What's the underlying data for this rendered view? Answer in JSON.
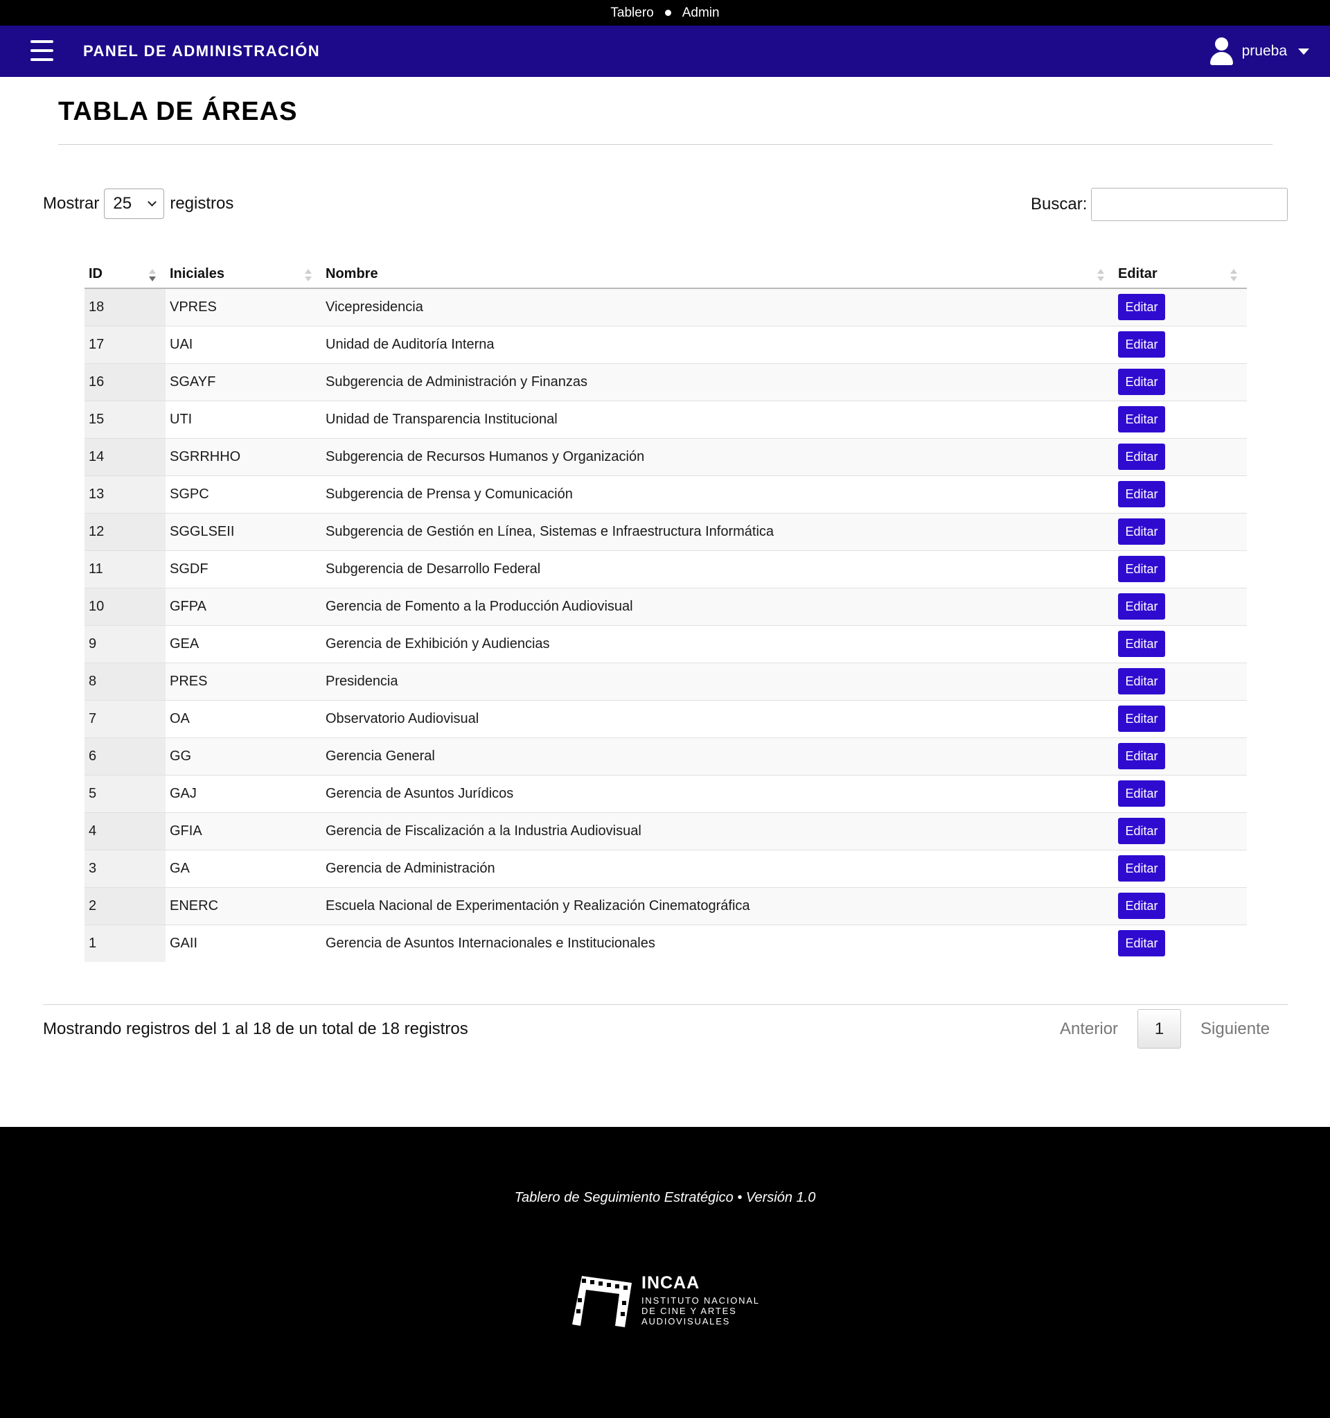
{
  "breadcrumb": {
    "home": "Tablero",
    "current": "Admin"
  },
  "header": {
    "title": "PANEL DE ADMINISTRACIÓN",
    "user": "prueba",
    "bg_color": "#1d0a8a"
  },
  "page": {
    "title": "TABLA DE ÁREAS"
  },
  "controls": {
    "show_label": "Mostrar",
    "page_length": "25",
    "records_label": "registros",
    "search_label": "Buscar:",
    "search_value": ""
  },
  "table": {
    "columns": [
      "ID",
      "Iniciales",
      "Nombre",
      "Editar"
    ],
    "edit_label": "Editar",
    "rows": [
      {
        "id": "18",
        "initials": "VPRES",
        "name": "Vicepresidencia"
      },
      {
        "id": "17",
        "initials": "UAI",
        "name": "Unidad de Auditoría Interna"
      },
      {
        "id": "16",
        "initials": "SGAYF",
        "name": "Subgerencia de Administración y Finanzas"
      },
      {
        "id": "15",
        "initials": "UTI",
        "name": "Unidad de Transparencia Institucional"
      },
      {
        "id": "14",
        "initials": "SGRRHHO",
        "name": "Subgerencia de Recursos Humanos y Organización"
      },
      {
        "id": "13",
        "initials": "SGPC",
        "name": "Subgerencia de Prensa y Comunicación"
      },
      {
        "id": "12",
        "initials": "SGGLSEII",
        "name": "Subgerencia de Gestión en Línea, Sistemas e Infraestructura Informática"
      },
      {
        "id": "11",
        "initials": "SGDF",
        "name": "Subgerencia de Desarrollo Federal"
      },
      {
        "id": "10",
        "initials": "GFPA",
        "name": "Gerencia de Fomento a la Producción Audiovisual"
      },
      {
        "id": "9",
        "initials": "GEA",
        "name": "Gerencia de Exhibición y Audiencias"
      },
      {
        "id": "8",
        "initials": "PRES",
        "name": "Presidencia"
      },
      {
        "id": "7",
        "initials": "OA",
        "name": "Observatorio Audiovisual"
      },
      {
        "id": "6",
        "initials": "GG",
        "name": "Gerencia General"
      },
      {
        "id": "5",
        "initials": "GAJ",
        "name": "Gerencia de Asuntos Jurídicos"
      },
      {
        "id": "4",
        "initials": "GFIA",
        "name": "Gerencia de Fiscalización a la Industria Audiovisual"
      },
      {
        "id": "3",
        "initials": "GA",
        "name": "Gerencia de Administración"
      },
      {
        "id": "2",
        "initials": "ENERC",
        "name": "Escuela Nacional de Experimentación y Realización Cinematográfica"
      },
      {
        "id": "1",
        "initials": "GAII",
        "name": "Gerencia de Asuntos Internacionales e Institucionales"
      }
    ]
  },
  "table_info": "Mostrando registros del 1 al 18 de un total de 18 registros",
  "pagination": {
    "previous": "Anterior",
    "current": "1",
    "next": "Siguiente"
  },
  "footer": {
    "text": "Tablero de Seguimiento Estratégico • Versión 1.0",
    "logo_name": "INCAA",
    "logo_line1": "INSTITUTO NACIONAL",
    "logo_line2": "DE CINE Y ARTES",
    "logo_line3": "AUDIOVISUALES"
  },
  "colors": {
    "accent": "#2f0bd0",
    "header": "#1d0a8a",
    "footer": "#000000"
  },
  "icons": [
    "menu-icon",
    "user-icon",
    "caret-down-icon",
    "sort-icon",
    "chevron-down-icon",
    "incaa-logo-icon"
  ]
}
